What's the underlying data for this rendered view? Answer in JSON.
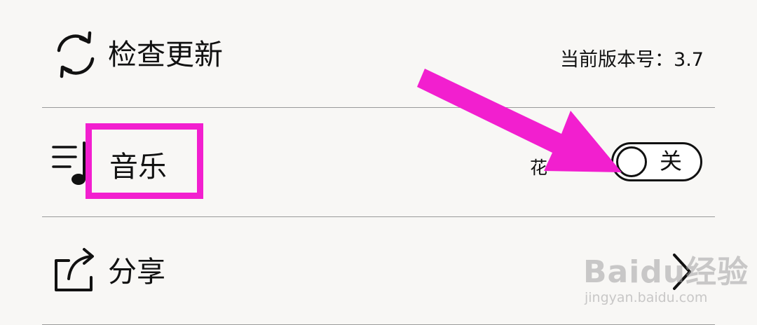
{
  "rows": {
    "check_update": {
      "label": "检查更新",
      "icon": "refresh-icon",
      "version_text": "当前版本号：3.7"
    },
    "music": {
      "label": "音乐",
      "icon": "music-list-icon",
      "autoplay_text": "花",
      "toggle_text": "关",
      "toggle_state": "off"
    },
    "share": {
      "label": "分享",
      "icon": "share-icon",
      "chevron_icon": "chevron-right-icon"
    }
  },
  "annotations": {
    "highlight_color": "#f21fcf",
    "arrow_color": "#f21fcf"
  },
  "watermark": {
    "brand": "Baidu经验",
    "url": "jingyan.baidu.com"
  }
}
